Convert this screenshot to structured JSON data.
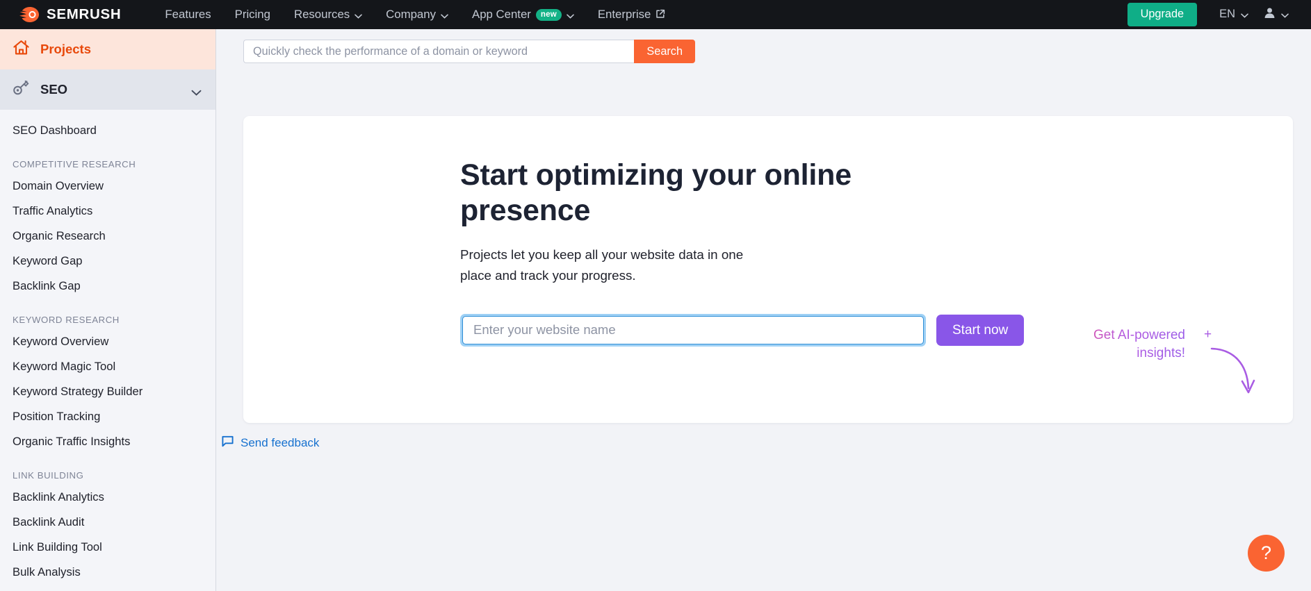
{
  "brand": {
    "name": "SEMRUSH",
    "logo_icon": "semrush-comet-logo",
    "accent_orange": "#fa6432",
    "accent_green": "#0fae87",
    "accent_purple": "#8956e8",
    "accent_blue": "#1771cf"
  },
  "topnav": {
    "items": [
      {
        "label": "Features",
        "has_dropdown": false,
        "icon": ""
      },
      {
        "label": "Pricing",
        "has_dropdown": false,
        "icon": ""
      },
      {
        "label": "Resources",
        "has_dropdown": true,
        "icon": "chevron-down-icon"
      },
      {
        "label": "Company",
        "has_dropdown": true,
        "icon": "chevron-down-icon"
      },
      {
        "label": "App Center",
        "has_dropdown": true,
        "badge": "new",
        "icon": "chevron-down-icon"
      },
      {
        "label": "Enterprise",
        "has_dropdown": false,
        "icon": "external-link-icon"
      }
    ],
    "upgrade_label": "Upgrade",
    "language": "EN",
    "user_icon": "user-avatar-icon"
  },
  "sidebar": {
    "projects_label": "Projects",
    "projects_icon": "home-icon",
    "seo_label": "SEO",
    "seo_icon": "key-icon",
    "seo_chevron": "chevron-down-icon",
    "dashboard_label": "SEO Dashboard",
    "sections": [
      {
        "title": "COMPETITIVE RESEARCH",
        "items": [
          "Domain Overview",
          "Traffic Analytics",
          "Organic Research",
          "Keyword Gap",
          "Backlink Gap"
        ]
      },
      {
        "title": "KEYWORD RESEARCH",
        "items": [
          "Keyword Overview",
          "Keyword Magic Tool",
          "Keyword Strategy Builder",
          "Position Tracking",
          "Organic Traffic Insights"
        ]
      },
      {
        "title": "LINK BUILDING",
        "items": [
          "Backlink Analytics",
          "Backlink Audit",
          "Link Building Tool",
          "Bulk Analysis"
        ]
      }
    ]
  },
  "search": {
    "placeholder": "Quickly check the performance of a domain or keyword",
    "value": "",
    "button_label": "Search"
  },
  "hero": {
    "title": "Start optimizing your online presence",
    "subtitle": "Projects let you keep all your website data in one place and track your progress.",
    "website_placeholder": "Enter your website name",
    "website_value": "",
    "start_button_label": "Start now",
    "ai_annotation": "Get AI-powered insights!",
    "ai_sparkle": "+",
    "ai_arrow_icon": "curved-arrow-down-icon"
  },
  "footer": {
    "feedback_label": "Send feedback",
    "feedback_icon": "speech-bubble-icon",
    "help_label": "?",
    "help_icon": "question-mark-icon"
  }
}
